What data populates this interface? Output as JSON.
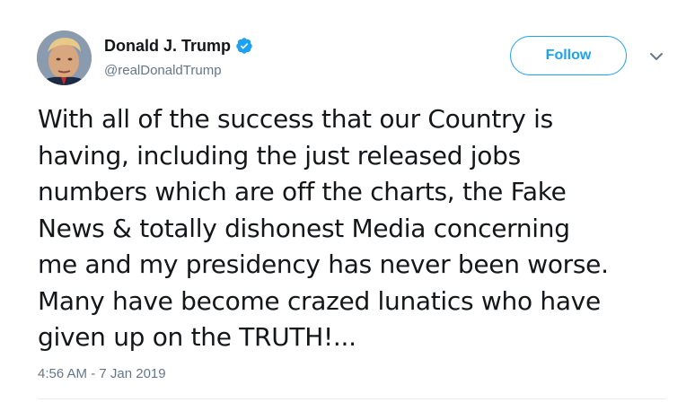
{
  "user": {
    "display_name": "Donald J. Trump",
    "handle": "@realDonaldTrump",
    "verified": true
  },
  "actions": {
    "follow_label": "Follow"
  },
  "tweet": {
    "lines": [
      "With all of the success that our Country is",
      "having, including the just released jobs",
      "numbers which are off the charts, the Fake",
      "News & totally dishonest Media concerning",
      "me and my presidency has never been worse.",
      "Many have become crazed lunatics who have",
      "given up on the TRUTH!..."
    ],
    "timestamp": "4:56 AM - 7 Jan 2019"
  },
  "colors": {
    "accent": "#1da1f2",
    "text": "#14171a",
    "muted": "#657786"
  },
  "icons": {
    "verified": "verified-badge-icon",
    "caret": "chevron-down-icon"
  }
}
